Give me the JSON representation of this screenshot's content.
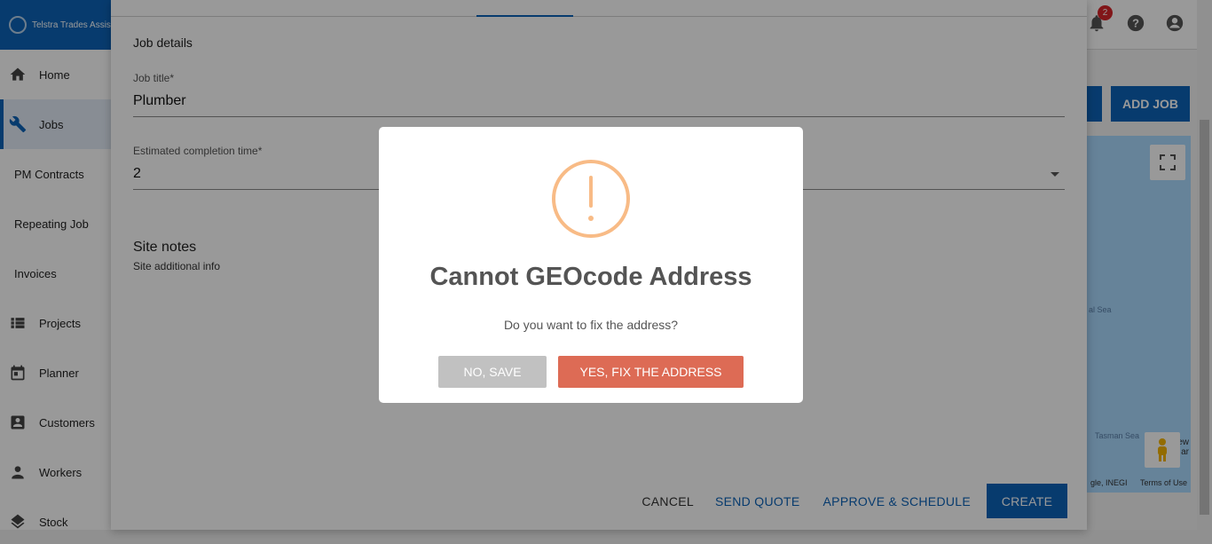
{
  "app": {
    "brand": "Telstra Trades Assist",
    "notification_count": "2"
  },
  "sidebar": {
    "items": [
      {
        "label": "Home"
      },
      {
        "label": "Jobs"
      },
      {
        "label": "PM Contracts"
      },
      {
        "label": "Repeating Job"
      },
      {
        "label": "Invoices"
      },
      {
        "label": "Projects"
      },
      {
        "label": "Planner"
      },
      {
        "label": "Customers"
      },
      {
        "label": "Workers"
      },
      {
        "label": "Stock"
      }
    ]
  },
  "background": {
    "add_job_label": "ADD JOB",
    "map": {
      "label_coral_sea": "al Sea",
      "label_tasman_sea": "Tasman Sea",
      "label_new": "ew",
      "label_ar": "ar",
      "attribution": "gle, INEGI",
      "terms": "Terms of Use"
    }
  },
  "job_form": {
    "section_title": "Job details",
    "job_title_label": "Job title*",
    "job_title_value": "Plumber",
    "completion_label": "Estimated completion time*",
    "completion_value": "2",
    "site_notes_title": "Site notes",
    "site_notes_sub": "Site additional info",
    "actions": {
      "cancel": "CANCEL",
      "send_quote": "SEND QUOTE",
      "approve": "APPROVE & SCHEDULE",
      "create": "CREATE"
    }
  },
  "dialog": {
    "icon": "warning-icon",
    "title": "Cannot GEOcode Address",
    "text": "Do you want to fix the address?",
    "no_label": "NO, SAVE",
    "yes_label": "YES, FIX THE ADDRESS",
    "warning_color": "#f8bb86",
    "yes_color": "#dd6b55",
    "no_color": "#c1c1c1"
  },
  "colors": {
    "brand_blue": "#0d63b8"
  }
}
